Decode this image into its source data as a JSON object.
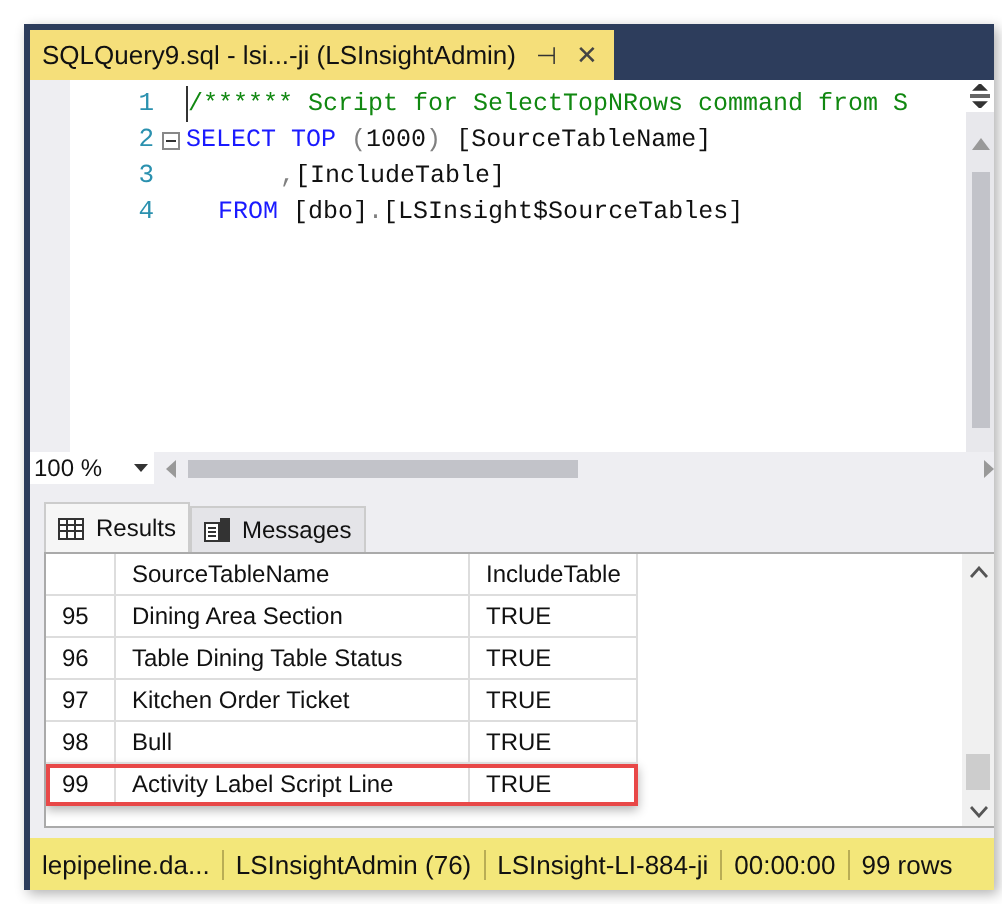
{
  "document_tab": {
    "title": "SQLQuery9.sql - lsi...-ji (LSInsightAdmin)",
    "pin": "⊣",
    "close": "✕"
  },
  "editor": {
    "lines": [
      {
        "number": "1",
        "tokens": [
          {
            "kind": "comment",
            "text": "/****** Script for SelectTopNRows command from S"
          }
        ]
      },
      {
        "number": "2",
        "fold": true,
        "tokens": [
          {
            "kind": "keyword",
            "text": "SELECT TOP "
          },
          {
            "kind": "punct",
            "text": "("
          },
          {
            "kind": "plain",
            "text": "1000"
          },
          {
            "kind": "punct",
            "text": ")"
          },
          {
            "kind": "plain",
            "text": " [SourceTableName]"
          }
        ]
      },
      {
        "number": "3",
        "kind": "continuation",
        "tokens": [
          {
            "kind": "punct",
            "text": ","
          },
          {
            "kind": "plain",
            "text": "[IncludeTable]"
          }
        ]
      },
      {
        "number": "4",
        "kind": "clause",
        "tokens": [
          {
            "kind": "keyword",
            "text": "FROM "
          },
          {
            "kind": "plain",
            "text": "[dbo]"
          },
          {
            "kind": "punct",
            "text": "."
          },
          {
            "kind": "plain",
            "text": "[LSInsight$SourceTables]"
          }
        ]
      }
    ]
  },
  "zoom": "100 %",
  "result_tabs": [
    {
      "label": "Results",
      "selected": true,
      "kind": "grid"
    },
    {
      "label": "Messages",
      "selected": false,
      "kind": "messages"
    }
  ],
  "grid": {
    "columns": [
      "SourceTableName",
      "IncludeTable"
    ],
    "rows": [
      {
        "number": "95",
        "name": "Dining Area Section",
        "include": "TRUE",
        "highlighted": false
      },
      {
        "number": "96",
        "name": "Table Dining Table Status",
        "include": "TRUE",
        "highlighted": false
      },
      {
        "number": "97",
        "name": "Kitchen Order Ticket",
        "include": "TRUE",
        "highlighted": false
      },
      {
        "number": "98",
        "name": "Bull",
        "include": "TRUE",
        "highlighted": false
      },
      {
        "number": "99",
        "name": "Activity Label Script Line",
        "include": "TRUE",
        "highlighted": true
      }
    ]
  },
  "status_bar": [
    "lepipeline.da...",
    "LSInsightAdmin (76)",
    "LSInsight-LI-884-ji",
    "00:00:00",
    "99 rows"
  ]
}
